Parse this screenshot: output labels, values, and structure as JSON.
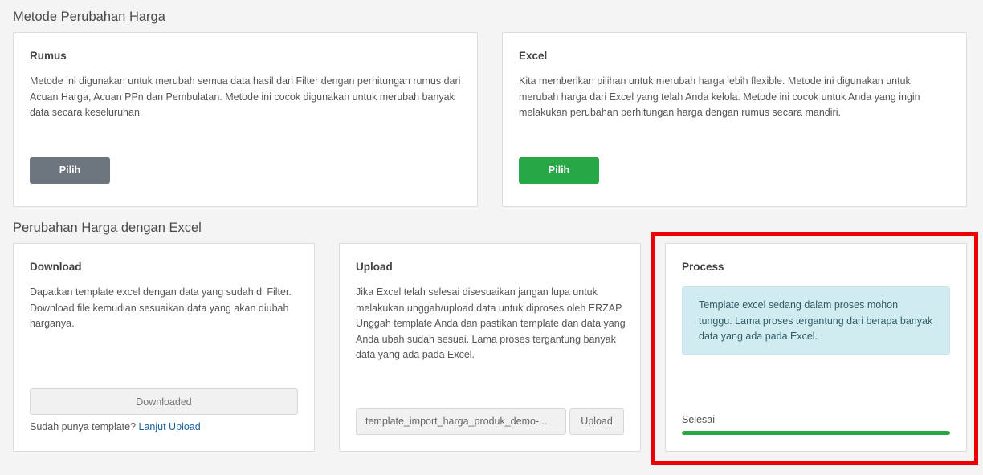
{
  "sections": {
    "method_title": "Metode Perubahan Harga",
    "excel_title": "Perubahan Harga dengan Excel"
  },
  "rumus": {
    "title": "Rumus",
    "description": "Metode ini digunakan untuk merubah semua data hasil dari Filter dengan perhitungan rumus dari Acuan Harga, Acuan PPn dan Pembulatan. Metode ini cocok digunakan untuk merubah banyak data secara keseluruhan.",
    "button_label": "Pilih"
  },
  "excel": {
    "title": "Excel",
    "description": "Kita memberikan pilihan untuk merubah harga lebih flexible. Metode ini digunakan untuk merubah harga dari Excel yang telah Anda kelola. Metode ini cocok untuk Anda yang ingin melakukan perubahan perhitungan harga dengan rumus secara mandiri.",
    "button_label": "Pilih"
  },
  "download": {
    "title": "Download",
    "description": "Dapatkan template excel dengan data yang sudah di Filter. Download file kemudian sesuaikan data yang akan diubah harganya.",
    "button_label": "Downloaded",
    "footnote_text": "Sudah punya template?",
    "footnote_link": "Lanjut Upload"
  },
  "upload": {
    "title": "Upload",
    "description": "Jika Excel telah selesai disesuaikan jangan lupa untuk melakukan unggah/upload data untuk diproses oleh ERZAP. Unggah template Anda dan pastikan template dan data yang Anda ubah sudah sesuai. Lama proses tergantung banyak data yang ada pada Excel.",
    "file_name": "template_import_harga_produk_demo-...",
    "button_label": "Upload"
  },
  "process": {
    "title": "Process",
    "alert_text": "Template excel sedang dalam proses mohon tunggu. Lama proses tergantung dari berapa banyak data yang ada pada Excel.",
    "status_label": "Selesai",
    "progress": 1.0
  },
  "colors": {
    "green": "#28a745",
    "grey": "#6c757d",
    "highlight": "#ee0000"
  }
}
